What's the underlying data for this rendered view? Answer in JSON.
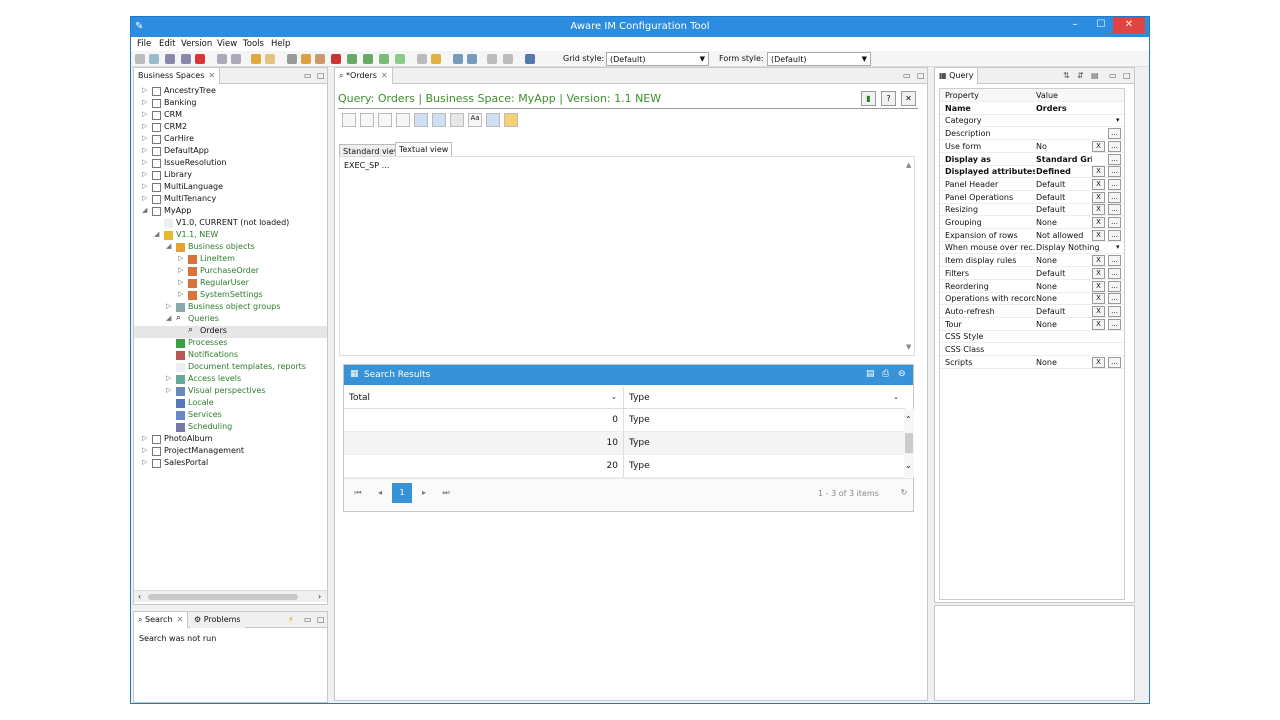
{
  "window": {
    "title": "Aware IM Configuration Tool",
    "min": "–",
    "max": "☐",
    "close": "✕"
  },
  "menu": [
    "File",
    "Edit",
    "Version",
    "View",
    "Tools",
    "Help"
  ],
  "toolbar": {
    "grid_style_label": "Grid style:",
    "grid_style_value": "(Default)",
    "form_style_label": "Form style:",
    "form_style_value": "(Default)"
  },
  "left_panel": {
    "tab": "Business Spaces",
    "items": [
      {
        "label": "AncestryTree",
        "level": 0,
        "exp": "▷",
        "icon": "folder"
      },
      {
        "label": "Banking",
        "level": 0,
        "exp": "▷",
        "icon": "folder"
      },
      {
        "label": "CRM",
        "level": 0,
        "exp": "▷",
        "icon": "folder"
      },
      {
        "label": "CRM2",
        "level": 0,
        "exp": "▷",
        "icon": "folder"
      },
      {
        "label": "CarHire",
        "level": 0,
        "exp": "▷",
        "icon": "folder"
      },
      {
        "label": "DefaultApp",
        "level": 0,
        "exp": "▷",
        "icon": "folder"
      },
      {
        "label": "IssueResolution",
        "level": 0,
        "exp": "▷",
        "icon": "folder"
      },
      {
        "label": "Library",
        "level": 0,
        "exp": "▷",
        "icon": "folder"
      },
      {
        "label": "MultiLanguage",
        "level": 0,
        "exp": "▷",
        "icon": "folder"
      },
      {
        "label": "MultiTenancy",
        "level": 0,
        "exp": "▷",
        "icon": "folder"
      },
      {
        "label": "MyApp",
        "level": 0,
        "exp": "◢",
        "icon": "folder"
      },
      {
        "label": "V1.0, CURRENT (not loaded)",
        "level": 1,
        "exp": "",
        "icon": "doc"
      },
      {
        "label": "V1.1, NEW",
        "level": 1,
        "exp": "◢",
        "icon": "version",
        "green": true
      },
      {
        "label": "Business objects",
        "level": 2,
        "exp": "◢",
        "icon": "bo",
        "green": true
      },
      {
        "label": "LineItem",
        "level": 3,
        "exp": "▷",
        "icon": "grid",
        "green": true
      },
      {
        "label": "PurchaseOrder",
        "level": 3,
        "exp": "▷",
        "icon": "grid",
        "green": true
      },
      {
        "label": "RegularUser",
        "level": 3,
        "exp": "▷",
        "icon": "grid",
        "green": true
      },
      {
        "label": "SystemSettings",
        "level": 3,
        "exp": "▷",
        "icon": "grid",
        "green": true
      },
      {
        "label": "Business object groups",
        "level": 2,
        "exp": "▷",
        "icon": "group",
        "green": true
      },
      {
        "label": "Queries",
        "level": 2,
        "exp": "◢",
        "icon": "search",
        "green": true
      },
      {
        "label": "Orders",
        "level": 3,
        "exp": "",
        "icon": "search",
        "selected": true
      },
      {
        "label": "Processes",
        "level": 2,
        "exp": "",
        "icon": "process",
        "green": true
      },
      {
        "label": "Notifications",
        "level": 2,
        "exp": "",
        "icon": "notif",
        "green": true
      },
      {
        "label": "Document templates, reports",
        "level": 2,
        "exp": "",
        "icon": "doc",
        "green": true
      },
      {
        "label": "Access levels",
        "level": 2,
        "exp": "▷",
        "icon": "access",
        "green": true
      },
      {
        "label": "Visual perspectives",
        "level": 2,
        "exp": "▷",
        "icon": "visual",
        "green": true
      },
      {
        "label": "Locale",
        "level": 2,
        "exp": "",
        "icon": "locale",
        "green": true
      },
      {
        "label": "Services",
        "level": 2,
        "exp": "",
        "icon": "services",
        "green": true
      },
      {
        "label": "Scheduling",
        "level": 2,
        "exp": "",
        "icon": "sched",
        "green": true
      },
      {
        "label": "PhotoAlbum",
        "level": 0,
        "exp": "▷",
        "icon": "folder"
      },
      {
        "label": "ProjectManagement",
        "level": 0,
        "exp": "▷",
        "icon": "folder"
      },
      {
        "label": "SalesPortal",
        "level": 0,
        "exp": "▷",
        "icon": "folder"
      }
    ]
  },
  "bottom_left": {
    "tab1": "Search",
    "tab2": "Problems",
    "message": "Search was not run"
  },
  "editor": {
    "tab": "*Orders",
    "header": "Query: Orders  |  Business Space: MyApp  |  Version: 1.1 NEW",
    "view_tabs": [
      "Standard view",
      "Textual view"
    ],
    "text": "EXEC_SP ..."
  },
  "results": {
    "title": "Search Results",
    "columns": [
      "Total",
      "Type"
    ],
    "rows": [
      {
        "total": "0",
        "type": "Type"
      },
      {
        "total": "10",
        "type": "Type"
      },
      {
        "total": "20",
        "type": "Type"
      }
    ],
    "page": "1",
    "summary": "1 - 3 of 3 items"
  },
  "properties": {
    "tab": "Query",
    "header_property": "Property",
    "header_value": "Value",
    "rows": [
      {
        "k": "Name",
        "v": "Orders",
        "bold": true,
        "btns": ""
      },
      {
        "k": "Category",
        "v": "",
        "btns": "dd"
      },
      {
        "k": "Description",
        "v": "",
        "btns": "e"
      },
      {
        "k": "Use form",
        "v": "No",
        "btns": "xe"
      },
      {
        "k": "Display as",
        "v": "Standard Grid",
        "bold": true,
        "btns": "e"
      },
      {
        "k": "Displayed attributes",
        "v": "Defined",
        "bold": true,
        "btns": "xe"
      },
      {
        "k": "Panel Header",
        "v": "Default",
        "btns": "xe"
      },
      {
        "k": "Panel Operations",
        "v": "Default",
        "btns": "xe"
      },
      {
        "k": "Resizing",
        "v": "Default",
        "btns": "xe"
      },
      {
        "k": "Grouping",
        "v": "None",
        "btns": "xe"
      },
      {
        "k": "Expansion of rows",
        "v": "Not allowed",
        "btns": "xe"
      },
      {
        "k": "When mouse over rec...",
        "v": "Display Nothing",
        "btns": "dd"
      },
      {
        "k": "Item display rules",
        "v": "None",
        "btns": "xe"
      },
      {
        "k": "Filters",
        "v": "Default",
        "btns": "xe"
      },
      {
        "k": "Reordering",
        "v": "None",
        "btns": "xe"
      },
      {
        "k": "Operations with records",
        "v": "None",
        "btns": "xe"
      },
      {
        "k": "Auto-refresh",
        "v": "Default",
        "btns": "xe"
      },
      {
        "k": "Tour",
        "v": "None",
        "btns": "xe"
      },
      {
        "k": "CSS Style",
        "v": "",
        "btns": ""
      },
      {
        "k": "CSS Class",
        "v": "",
        "btns": ""
      },
      {
        "k": "Scripts",
        "v": "None",
        "btns": "xe"
      }
    ]
  },
  "colors": {
    "accent": "#3892d8",
    "title": "#2b8ce0",
    "green": "#3e8e2c",
    "close": "#e04343"
  }
}
